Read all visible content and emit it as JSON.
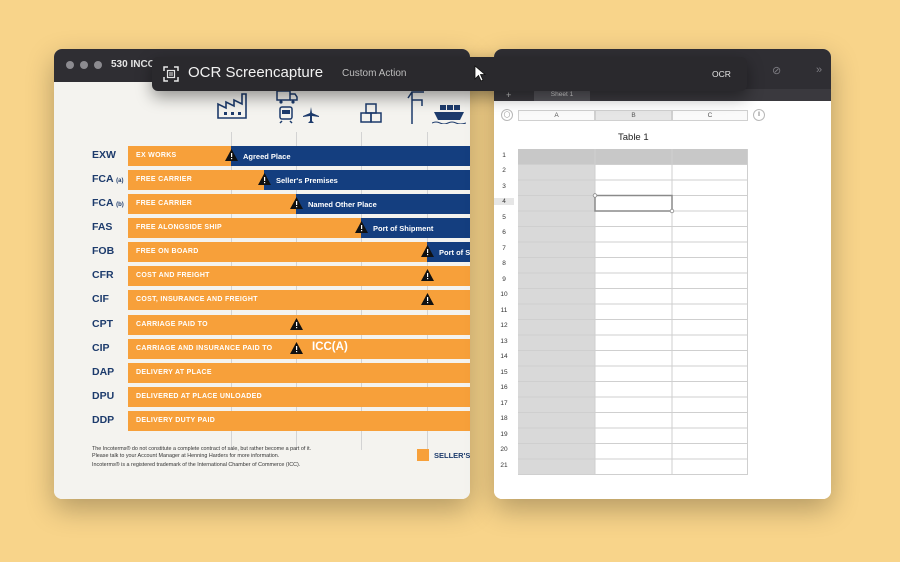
{
  "left_window": {
    "title": "530 INCO"
  },
  "incoterms": [
    {
      "code": "EXW",
      "sub": "",
      "label": "EX WORKS",
      "blue_text": "Agreed Place"
    },
    {
      "code": "FCA",
      "sub": "(a)",
      "label": "FREE CARRIER",
      "blue_text": "Seller's Premises"
    },
    {
      "code": "FCA",
      "sub": "(b)",
      "label": "FREE CARRIER",
      "blue_text": "Named Other Place"
    },
    {
      "code": "FAS",
      "sub": "",
      "label": "FREE ALONGSIDE SHIP",
      "blue_text": "Port of Shipment"
    },
    {
      "code": "FOB",
      "sub": "",
      "label": "FREE ON BOARD",
      "blue_text": "Port of S"
    },
    {
      "code": "CFR",
      "sub": "",
      "label": "COST AND FREIGHT",
      "blue_text": ""
    },
    {
      "code": "CIF",
      "sub": "",
      "label": "COST, INSURANCE AND FREIGHT",
      "blue_text": ""
    },
    {
      "code": "CPT",
      "sub": "",
      "label": "CARRIAGE PAID TO",
      "blue_text": ""
    },
    {
      "code": "CIP",
      "sub": "",
      "label": "CARRIAGE AND INSURANCE PAID TO",
      "blue_text": ""
    },
    {
      "code": "DAP",
      "sub": "",
      "label": "DELIVERY AT PLACE",
      "blue_text": ""
    },
    {
      "code": "DPU",
      "sub": "",
      "label": "DELIVERED AT PLACE UNLOADED",
      "blue_text": ""
    },
    {
      "code": "DDP",
      "sub": "",
      "label": "DELIVERY DUTY PAID",
      "blue_text": ""
    }
  ],
  "icc_text": "ICC(A)",
  "footnote": {
    "line1": "The Incoterms® do not constitute a complete contract of sale, but rather become a part of it.",
    "line2": "Please talk to your Account Manager at Henning Harders for more information.",
    "line3": "Incoterms® is a registered trademark of the International Chamber of Commerce (ICC)."
  },
  "legend": {
    "label": "SELLER'S",
    "color": "#f7a03a"
  },
  "colors": {
    "orange": "#f7a03a",
    "navy": "#143e7f",
    "code_text": "#1d3b6c"
  },
  "ocr_bar": {
    "title": "OCR Screencapture",
    "subtitle": "Custom Action",
    "right_label": "OCR"
  },
  "spreadsheet": {
    "sheet_tab": "Sheet 1",
    "add_tab": "+",
    "columns": [
      "A",
      "B",
      "C"
    ],
    "table_title": "Table 1",
    "rows": [
      "1",
      "2",
      "3",
      "4",
      "5",
      "6",
      "7",
      "8",
      "9",
      "10",
      "11",
      "12",
      "13",
      "14",
      "15",
      "16",
      "17",
      "18",
      "19",
      "20",
      "21"
    ],
    "selected_row": "4",
    "selected_column": "B"
  }
}
